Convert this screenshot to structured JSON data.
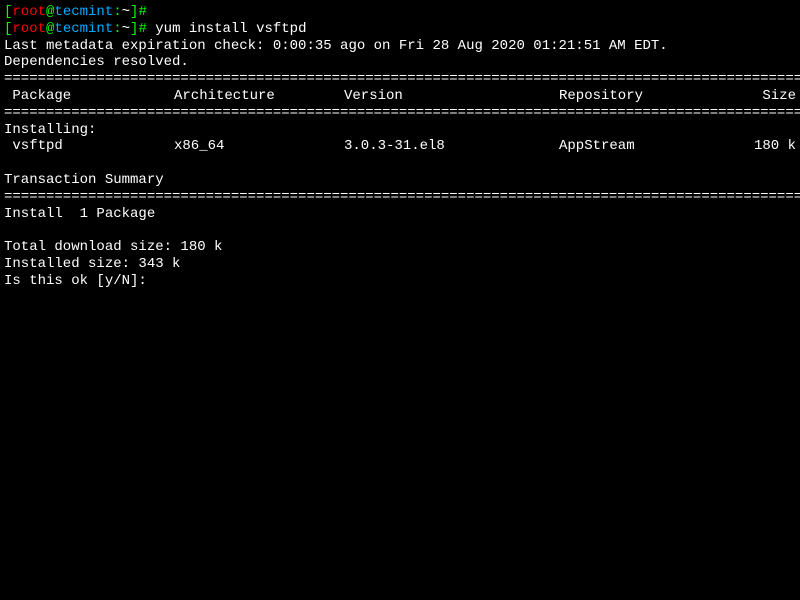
{
  "prompt1": {
    "user": "root",
    "at": "@",
    "host": "tecmint",
    "colon": ":",
    "path": "~",
    "close": "]",
    "hash": "#",
    "command": ""
  },
  "prompt2": {
    "user": "root",
    "at": "@",
    "host": "tecmint",
    "colon": ":",
    "path": "~",
    "close": "]",
    "hash": "#",
    "command": " yum install vsftpd"
  },
  "metadata_line": "Last metadata expiration check: 0:00:35 ago on Fri 28 Aug 2020 01:21:51 AM EDT.",
  "dependencies_line": "Dependencies resolved.",
  "divider": "================================================================================================",
  "headers": {
    "package": " Package",
    "architecture": "Architecture",
    "version": "Version",
    "repository": "Repository",
    "size": "Size"
  },
  "installing_label": "Installing:",
  "package_row": {
    "name": " vsftpd",
    "arch": "x86_64",
    "version": "3.0.3-31.el8",
    "repo": "AppStream",
    "size": "180 k"
  },
  "transaction_summary": "Transaction Summary",
  "install_count": "Install  1 Package",
  "download_size": "Total download size: 180 k",
  "installed_size": "Installed size: 343 k",
  "confirm_prompt": "Is this ok [y/N]: "
}
